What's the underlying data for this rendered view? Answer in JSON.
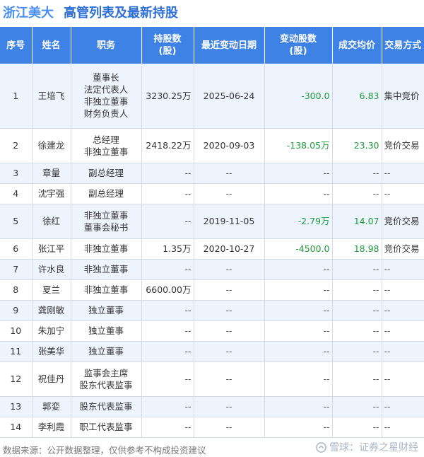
{
  "header": {
    "company": "浙江美大",
    "title": "高管列表及最新持股"
  },
  "table": {
    "headers": {
      "index": "序号",
      "name": "姓名",
      "position": "职务",
      "holding": "持股数\n(股)",
      "date": "最近变动日期",
      "change": "变动股数\n(股)",
      "price": "成交均价",
      "method": "交易方式"
    },
    "rows": [
      {
        "index": "1",
        "name": "王培飞",
        "position": "董事长\n法定代表人\n非独立董事\n财务负责人",
        "holding": "3230.25万",
        "date": "2025-06-24",
        "change": "-300.0",
        "price": "6.83",
        "method": "集中竞价"
      },
      {
        "index": "2",
        "name": "徐建龙",
        "position": "总经理\n非独立董事",
        "holding": "2418.22万",
        "date": "2020-09-03",
        "change": "-138.05万",
        "price": "23.30",
        "method": "竞价交易"
      },
      {
        "index": "3",
        "name": "章量",
        "position": "副总经理",
        "holding": "--",
        "date": "--",
        "change": "--",
        "price": "--",
        "method": "--"
      },
      {
        "index": "4",
        "name": "沈宇强",
        "position": "副总经理",
        "holding": "--",
        "date": "--",
        "change": "--",
        "price": "--",
        "method": "--"
      },
      {
        "index": "5",
        "name": "徐红",
        "position": "非独立董事\n董事会秘书",
        "holding": "--",
        "date": "2019-11-05",
        "change": "-2.79万",
        "price": "14.07",
        "method": "竞价交易"
      },
      {
        "index": "6",
        "name": "张江平",
        "position": "非独立董事",
        "holding": "1.35万",
        "date": "2020-10-27",
        "change": "-4500.0",
        "price": "18.98",
        "method": "竞价交易"
      },
      {
        "index": "7",
        "name": "许水良",
        "position": "非独立董事",
        "holding": "--",
        "date": "--",
        "change": "--",
        "price": "--",
        "method": "--"
      },
      {
        "index": "8",
        "name": "夏兰",
        "position": "非独立董事",
        "holding": "6600.00万",
        "date": "--",
        "change": "--",
        "price": "--",
        "method": "--"
      },
      {
        "index": "9",
        "name": "龚刚敏",
        "position": "独立董事",
        "holding": "--",
        "date": "--",
        "change": "--",
        "price": "--",
        "method": "--"
      },
      {
        "index": "10",
        "name": "朱加宁",
        "position": "独立董事",
        "holding": "--",
        "date": "--",
        "change": "--",
        "price": "--",
        "method": "--"
      },
      {
        "index": "11",
        "name": "张美华",
        "position": "独立董事",
        "holding": "--",
        "date": "--",
        "change": "--",
        "price": "--",
        "method": "--"
      },
      {
        "index": "12",
        "name": "祝佳丹",
        "position": "监事会主席\n股东代表监事",
        "holding": "--",
        "date": "--",
        "change": "--",
        "price": "--",
        "method": "--"
      },
      {
        "index": "13",
        "name": "郭娈",
        "position": "股东代表监事",
        "holding": "--",
        "date": "--",
        "change": "--",
        "price": "--",
        "method": "--"
      },
      {
        "index": "14",
        "name": "李利霞",
        "position": "职工代表监事",
        "holding": "--",
        "date": "--",
        "change": "--",
        "price": "--",
        "method": "--"
      }
    ]
  },
  "footer": {
    "source": "数据来源：公开数据整理，仅供参考不构成投资建议",
    "brand": "雪球：证券之星财经"
  },
  "colors": {
    "header_bg": "#3f82e6",
    "title": "#2f6fd6",
    "change_values": "#1e9b3a",
    "row_alt": "#eef4fd"
  }
}
